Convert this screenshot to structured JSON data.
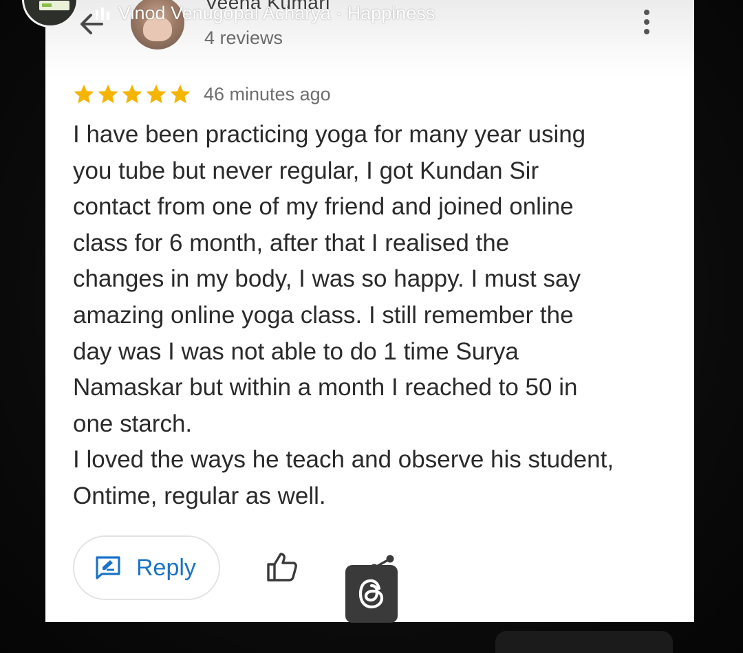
{
  "story_overlay": {
    "caption": "Vinod Venugopal Acharya · Happiness",
    "avatar_icon": "profile-thumbnail-icon"
  },
  "review_header": {
    "back_icon": "arrow-back-icon",
    "reviewer_name": "Veena Kumari",
    "reviewer_meta": "4 reviews",
    "more_icon": "more-vert-icon"
  },
  "review": {
    "rating": 5,
    "max_rating": 5,
    "star_color": "#f4b400",
    "time_ago": "46 minutes ago",
    "lines": [
      "I have been practicing yoga for many year using",
      "you tube but never regular, I got Kundan Sir",
      "contact from one of my friend and joined online",
      "class for 6 month, after that I realised the",
      "changes in my body, I was so happy. I must say",
      "amazing online yoga class. I still remember the",
      "day was I was not able to do 1 time Surya",
      "Namaskar but within a month I reached to 50 in",
      "one starch.",
      "I loved the ways he teach and observe his student,",
      "Ontime, regular as well."
    ]
  },
  "actions": {
    "reply_label": "Reply",
    "reply_icon": "reply-edit-icon",
    "like_icon": "thumb-up-icon",
    "share_icon": "share-icon",
    "accent_color": "#1a73c8"
  },
  "watermark": {
    "icon": "threads-logo-icon"
  }
}
